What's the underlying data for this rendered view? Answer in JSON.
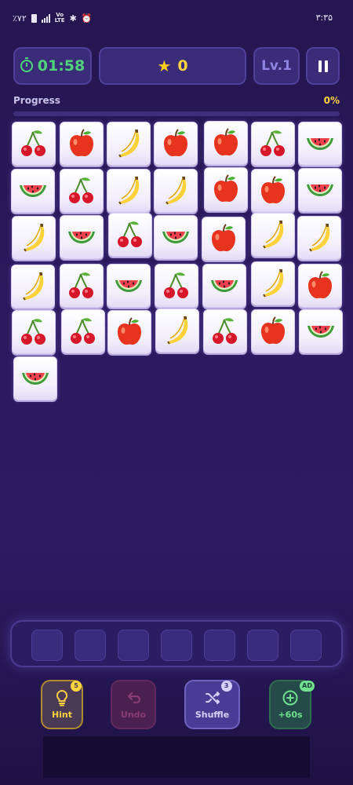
{
  "status_bar": {
    "left_text": "٪۷۲",
    "volte": "Vo\nLTE",
    "time": "۳:۳۵"
  },
  "hud": {
    "timer": "01:58",
    "score": "0",
    "level": "Lv.1"
  },
  "progress": {
    "label": "Progress",
    "value_text": "0%",
    "fraction": 0
  },
  "board": {
    "rows": [
      [
        "cherry",
        "apple",
        "banana",
        "apple",
        "apple",
        "cherry",
        "watermelon"
      ],
      [
        "watermelon",
        "cherry",
        "banana",
        "banana",
        "apple",
        "apple",
        "watermelon"
      ],
      [
        "banana",
        "watermelon",
        "cherry",
        "watermelon",
        "apple",
        "banana",
        "banana"
      ],
      [
        "banana",
        "cherry",
        "watermelon",
        "cherry",
        "watermelon",
        "banana",
        "apple"
      ],
      [
        "cherry",
        "cherry",
        "apple",
        "banana",
        "cherry",
        "apple",
        "watermelon"
      ],
      [
        "watermelon"
      ]
    ]
  },
  "tray": {
    "slot_count": 7
  },
  "powerups": {
    "hint": {
      "label": "Hint",
      "badge": "5",
      "icon": "lightbulb-icon"
    },
    "undo": {
      "label": "Undo",
      "icon": "undo-icon"
    },
    "shuffle": {
      "label": "Shuffle",
      "badge": "3",
      "icon": "shuffle-icon"
    },
    "time": {
      "label": "+60s",
      "badge": "AD",
      "icon": "plus-circle-icon"
    }
  },
  "colors": {
    "accent_green": "#4fd37a",
    "accent_yellow": "#ffd23f",
    "bg": "#2a1a5e"
  }
}
